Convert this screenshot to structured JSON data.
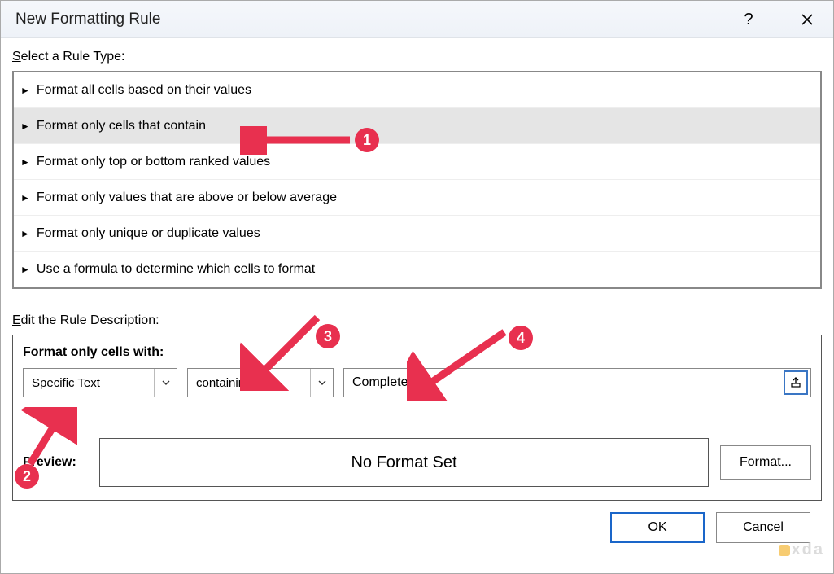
{
  "title": "New Formatting Rule",
  "select_label_html": "Select a Rule Type:",
  "rule_types": [
    "Format all cells based on their values",
    "Format only cells that contain",
    "Format only top or bottom ranked values",
    "Format only values that are above or below average",
    "Format only unique or duplicate values",
    "Use a formula to determine which cells to format"
  ],
  "selected_rule_index": 1,
  "edit_label": "Edit the Rule Description:",
  "format_with_label": "Format only cells with:",
  "condition_type": "Specific Text",
  "condition_operator": "containing",
  "condition_value": "Completed",
  "preview_label": "Preview:",
  "preview_text": "No Format Set",
  "format_button": "Format...",
  "ok_button": "OK",
  "cancel_button": "Cancel",
  "annotations": {
    "1": "1",
    "2": "2",
    "3": "3",
    "4": "4"
  },
  "brand": "xda"
}
